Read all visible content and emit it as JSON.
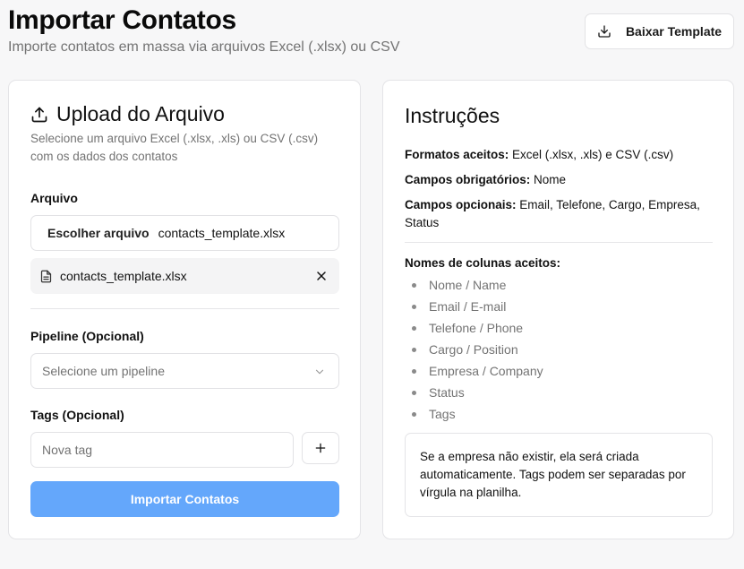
{
  "header": {
    "title": "Importar Contatos",
    "subtitle": "Importe contatos em massa via arquivos Excel (.xlsx) ou CSV",
    "download_label": "Baixar Template"
  },
  "upload": {
    "title": "Upload do Arquivo",
    "description": "Selecione um arquivo Excel (.xlsx, .xls) ou CSV (.csv) com os dados dos contatos",
    "file_label": "Arquivo",
    "choose_label": "Escolher arquivo",
    "file_name": "contacts_template.xlsx",
    "selected_file": "contacts_template.xlsx",
    "pipeline_label": "Pipeline (Opcional)",
    "pipeline_placeholder": "Selecione um pipeline",
    "tags_label": "Tags (Opcional)",
    "tags_placeholder": "Nova tag",
    "import_label": "Importar Contatos"
  },
  "instructions": {
    "title": "Instruções",
    "formats_label": "Formatos aceitos:",
    "formats_value": "Excel (.xlsx, .xls) e CSV (.csv)",
    "required_label": "Campos obrigatórios:",
    "required_value": "Nome",
    "optional_label": "Campos opcionais:",
    "optional_value": "Email, Telefone, Cargo, Empresa, Status",
    "columns_label": "Nomes de colunas aceitos:",
    "columns": [
      "Nome / Name",
      "Email / E-mail",
      "Telefone / Phone",
      "Cargo / Position",
      "Empresa / Company",
      "Status",
      "Tags"
    ],
    "note": "Se a empresa não existir, ela será criada automaticamente. Tags podem ser separadas por vírgula na planilha."
  },
  "colors": {
    "primary_button": "#64a7fb",
    "muted_text": "#737373",
    "border": "#e4e4e7"
  },
  "icons": {
    "download": "download-icon",
    "upload": "upload-icon",
    "file": "file-icon",
    "close": "close-icon",
    "chevron": "chevron-down-icon",
    "plus": "plus-icon"
  }
}
